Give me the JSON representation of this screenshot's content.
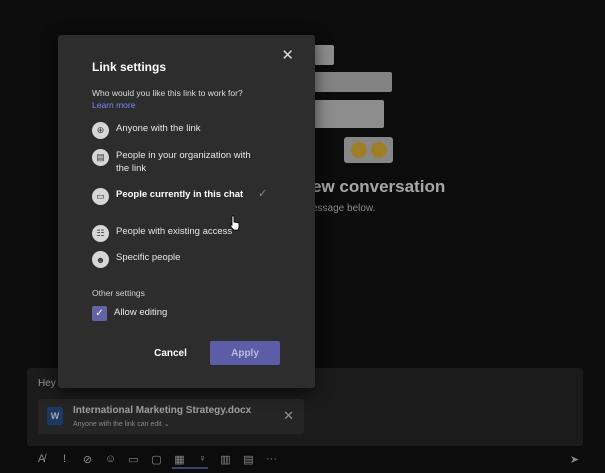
{
  "background": {
    "title": "ew conversation",
    "subtitle": "essage below."
  },
  "compose": {
    "text": "Hey",
    "attachment": {
      "name": "International Marketing Strategy.docx",
      "permission": "Anyone with the link can edit",
      "file_icon": "W"
    }
  },
  "dialog": {
    "title": "Link settings",
    "question": "Who would you like this link to work for?",
    "learn_more": "Learn more",
    "options": [
      {
        "label": "Anyone with the link",
        "icon": "globe-icon",
        "selected": false
      },
      {
        "label": "People in your organization with the link",
        "icon": "building-icon",
        "selected": false
      },
      {
        "label": "People currently in this chat",
        "icon": "chat-icon",
        "selected": true
      },
      {
        "label": "People with existing access",
        "icon": "people-icon",
        "selected": false
      },
      {
        "label": "Specific people",
        "icon": "person-icon",
        "selected": false
      }
    ],
    "other_settings_label": "Other settings",
    "allow_editing_label": "Allow editing",
    "allow_editing_checked": true,
    "cancel_label": "Cancel",
    "apply_label": "Apply"
  },
  "colors": {
    "accent": "#6264a7",
    "link": "#7f85f5"
  }
}
